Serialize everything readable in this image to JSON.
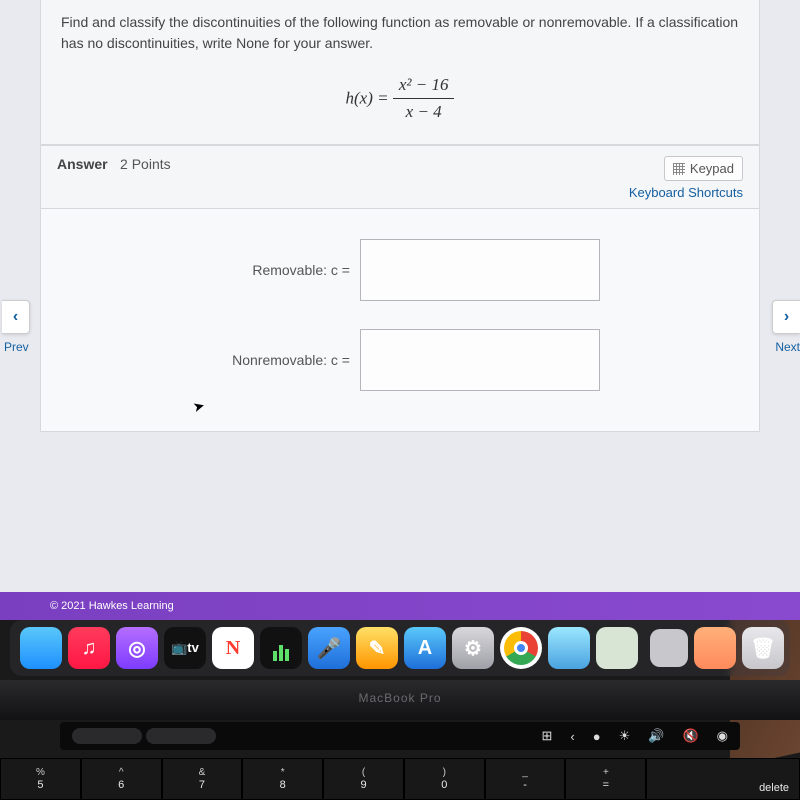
{
  "question": {
    "prompt": "Find and classify the discontinuities of the following function as removable or nonremovable. If a classification has no discontinuities, write None for your answer.",
    "equation": {
      "lhs": "h(x) =",
      "numerator": "x² − 16",
      "denominator": "x − 4"
    }
  },
  "answer_section": {
    "label": "Answer",
    "points": "2 Points",
    "keypad_button": "Keypad",
    "keyboard_shortcuts": "Keyboard Shortcuts",
    "fields": {
      "removable_label": "Removable: c =",
      "removable_value": "",
      "nonremovable_label": "Nonremovable: c =",
      "nonremovable_value": ""
    }
  },
  "nav": {
    "prev": "Prev",
    "prev_glyph": "‹",
    "next": "Next",
    "next_glyph": "›"
  },
  "footer": "© 2021 Hawkes Learning",
  "dock": {
    "music": "♫",
    "podcasts": "◎",
    "tv": "📺tv",
    "keynote": "🎤",
    "notes": "✎",
    "appstore": "A",
    "settings": "⚙",
    "trash": "🗑"
  },
  "laptop_model": "MacBook Pro",
  "touchbar": {
    "expand": "⊞",
    "back": "‹",
    "play": "●",
    "bright": "☀",
    "vol": "🔊",
    "mute": "🔇",
    "siri": "◉"
  },
  "keys": [
    {
      "top": "%",
      "bottom": "5"
    },
    {
      "top": "^",
      "bottom": "6"
    },
    {
      "top": "&",
      "bottom": "7"
    },
    {
      "top": "*",
      "bottom": "8"
    },
    {
      "top": "(",
      "bottom": "9"
    },
    {
      "top": ")",
      "bottom": "0"
    },
    {
      "top": "_",
      "bottom": "-"
    },
    {
      "top": "+",
      "bottom": "="
    }
  ],
  "delete_key": "delete"
}
